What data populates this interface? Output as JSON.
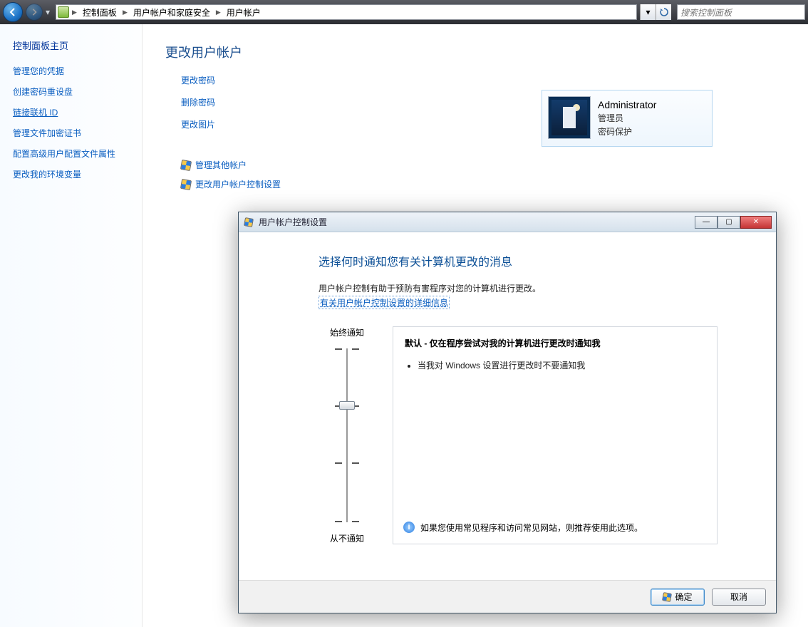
{
  "navbar": {
    "breadcrumbs": [
      "控制面板",
      "用户帐户和家庭安全",
      "用户帐户"
    ],
    "search_placeholder": "搜索控制面板"
  },
  "sidebar": {
    "title": "控制面板主页",
    "links": [
      {
        "label": "管理您的凭据",
        "underline": false
      },
      {
        "label": "创建密码重设盘",
        "underline": false
      },
      {
        "label": "链接联机 ID",
        "underline": true
      },
      {
        "label": "管理文件加密证书",
        "underline": false
      },
      {
        "label": "配置高级用户配置文件属性",
        "underline": false
      },
      {
        "label": "更改我的环境变量",
        "underline": false
      }
    ]
  },
  "main": {
    "title": "更改用户帐户",
    "actions": [
      "更改密码",
      "删除密码",
      "更改图片"
    ],
    "shield_actions": [
      "管理其他帐户",
      "更改用户帐户控制设置"
    ],
    "user": {
      "name": "Administrator",
      "role": "管理员",
      "protection": "密码保护"
    }
  },
  "dialog": {
    "title": "用户帐户控制设置",
    "heading": "选择何时通知您有关计算机更改的消息",
    "description": "用户帐户控制有助于预防有害程序对您的计算机进行更改。",
    "more_link": "有关用户帐户控制设置的详细信息",
    "slider_top": "始终通知",
    "slider_bottom": "从不通知",
    "info_title": "默认 - 仅在程序尝试对我的计算机进行更改时通知我",
    "info_bullets": [
      "当我对 Windows 设置进行更改时不要通知我"
    ],
    "info_tip": "如果您使用常见程序和访问常见网站，则推荐使用此选项。",
    "ok": "确定",
    "cancel": "取消"
  }
}
